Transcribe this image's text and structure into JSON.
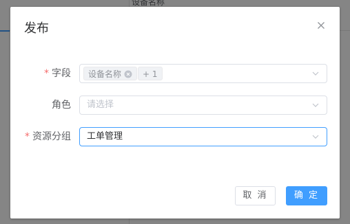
{
  "background": {
    "partial_text": "设备名称"
  },
  "dialog": {
    "title": "发布",
    "close_icon": "close-icon",
    "fields": {
      "field": {
        "label": "字段",
        "required": true,
        "tags": [
          "设备名称"
        ],
        "collapsed_count": "+ 1"
      },
      "role": {
        "label": "角色",
        "required": false,
        "placeholder": "请选择"
      },
      "group": {
        "label": "资源分组",
        "required": true,
        "value": "工单管理"
      }
    },
    "buttons": {
      "cancel": "取 消",
      "confirm": "确 定"
    }
  },
  "colors": {
    "primary": "#409eff",
    "required": "#f56c6c"
  }
}
